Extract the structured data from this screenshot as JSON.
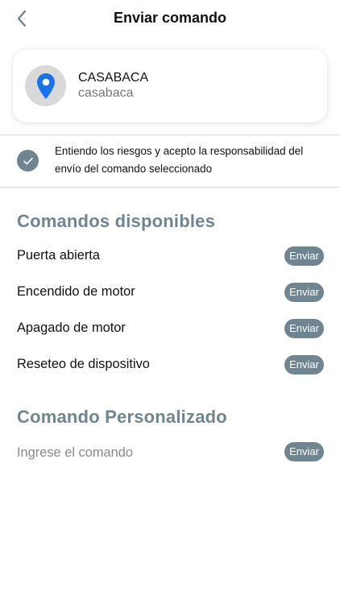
{
  "header": {
    "title": "Enviar comando",
    "back_icon": "chevron-left-icon"
  },
  "device": {
    "name": "CASABACA",
    "subtitle": "casabaca",
    "icon": "map-pin-icon",
    "pin_color": "#1a73e8"
  },
  "consent": {
    "text": "Entiendo los riesgos y acepto la responsabilidad del envío del comando seleccionado",
    "checked": true,
    "icon": "check-icon"
  },
  "available": {
    "title": "Comandos disponibles",
    "commands": [
      {
        "label": "Puerta abierta",
        "button": "Enviar"
      },
      {
        "label": "Encendido de motor",
        "button": "Enviar"
      },
      {
        "label": "Apagado de motor",
        "button": "Enviar"
      },
      {
        "label": "Reseteo de dispositivo",
        "button": "Enviar"
      }
    ]
  },
  "custom": {
    "title": "Comando Personalizado",
    "placeholder": "Ingrese el comando",
    "value": "",
    "button": "Enviar"
  },
  "colors": {
    "accent": "#6f8592",
    "divider": "#d6d6d6",
    "avatar_bg": "#d9d9d9"
  }
}
